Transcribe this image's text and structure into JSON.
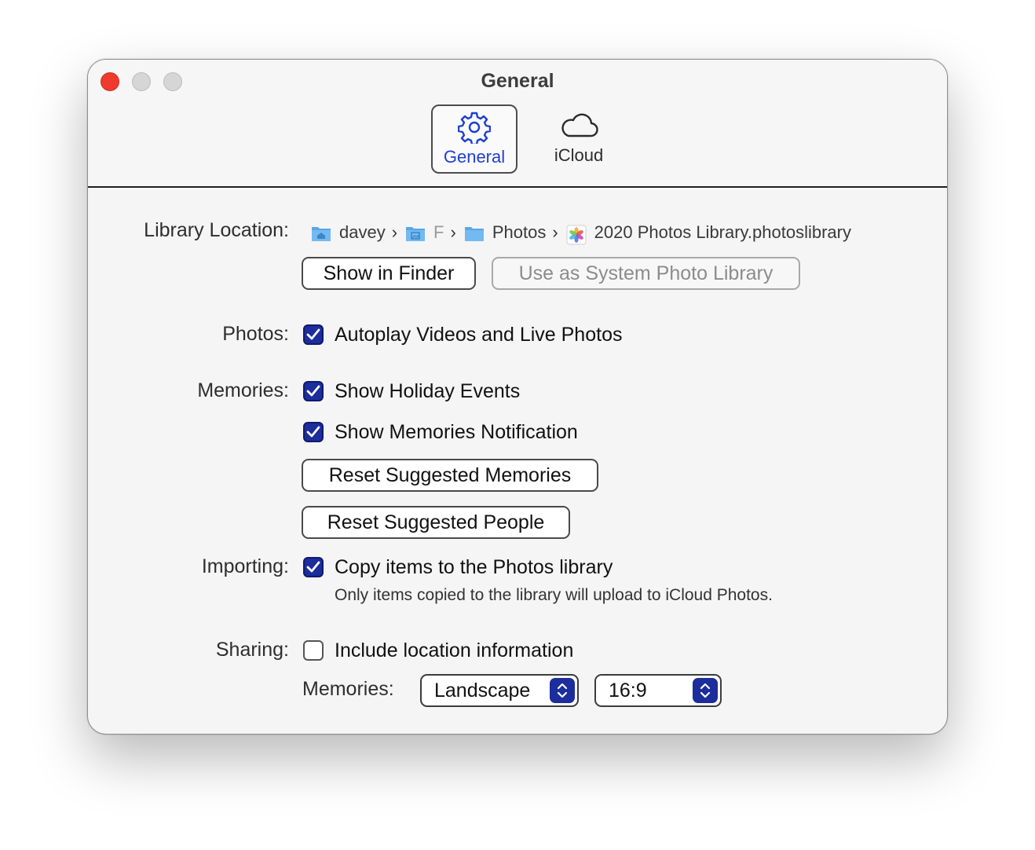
{
  "window": {
    "title": "General",
    "colors": {
      "accent": "#1c2d9c",
      "tab_selected_text": "#1f3fd1",
      "close": "#ee3b2e"
    }
  },
  "tabs": [
    {
      "label": "General",
      "icon": "gear-icon",
      "selected": true
    },
    {
      "label": "iCloud",
      "icon": "cloud-icon",
      "selected": false
    }
  ],
  "library": {
    "label": "Library Location:",
    "path": [
      {
        "name": "davey",
        "icon": "home-folder-icon"
      },
      {
        "name": "F",
        "icon": "pictures-folder-icon"
      },
      {
        "name": "Photos",
        "icon": "folder-icon"
      },
      {
        "name": "2020 Photos Library.photoslibrary",
        "icon": "photos-app-icon"
      }
    ],
    "show_in_finder": "Show in Finder",
    "use_as_system": "Use as System Photo Library"
  },
  "photos": {
    "label": "Photos:",
    "autoplay": {
      "label": "Autoplay Videos and Live Photos",
      "checked": true
    }
  },
  "memories": {
    "label": "Memories:",
    "holiday": {
      "label": "Show Holiday Events",
      "checked": true
    },
    "notification": {
      "label": "Show Memories Notification",
      "checked": true
    },
    "reset_memories": "Reset Suggested Memories",
    "reset_people": "Reset Suggested People"
  },
  "importing": {
    "label": "Importing:",
    "copy": {
      "label": "Copy items to the Photos library",
      "checked": true
    },
    "hint": "Only items copied to the library will upload to iCloud Photos."
  },
  "sharing": {
    "label": "Sharing:",
    "location": {
      "label": "Include location information",
      "checked": false
    },
    "memories_label": "Memories:",
    "orientation": "Landscape",
    "aspect": "16:9"
  }
}
